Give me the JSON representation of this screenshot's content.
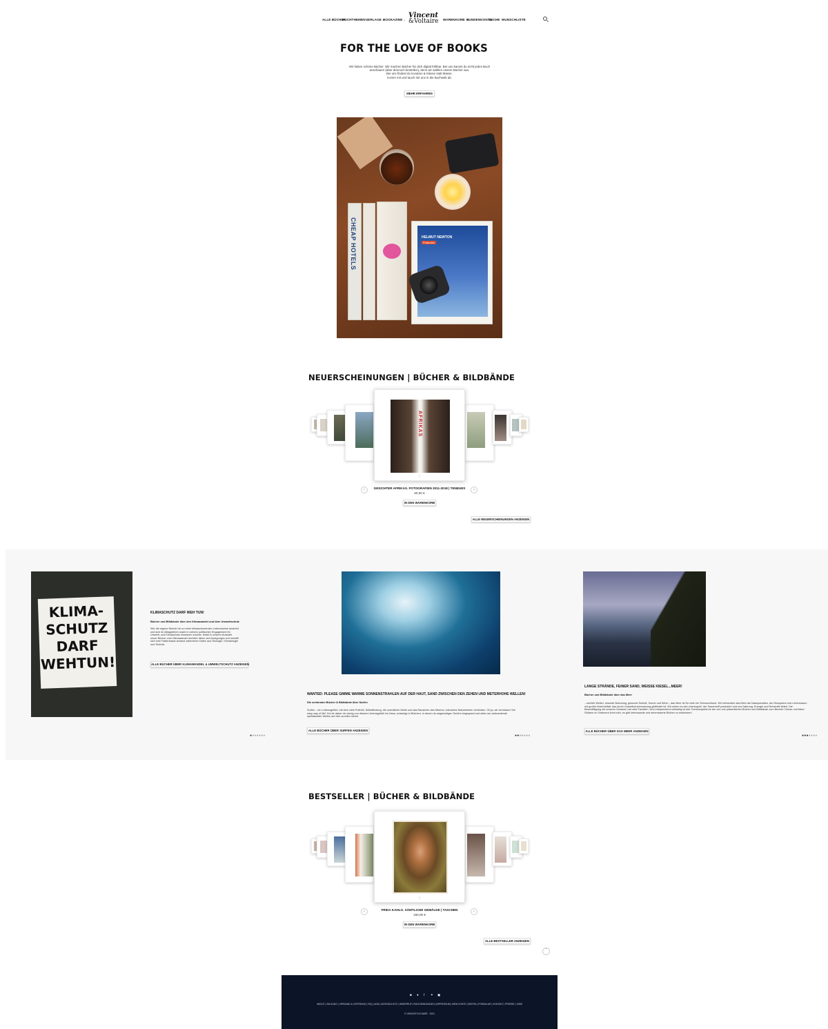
{
  "nav": {
    "left": [
      "ALLE BÜCHER",
      "BUCHTHEMEN",
      "VERLAGE",
      "BOOKAZINE"
    ],
    "right": [
      "WARENKORB",
      "KUNDENKONTO",
      "SUCHE",
      "WUNSCHLISTE"
    ],
    "cart_count": "0",
    "logo_line1": "Vincent",
    "logo_line2": "&Voltaire"
  },
  "hero": {
    "title": "FOR THE LOVE OF BOOKS",
    "lines": [
      "Wir lieben schöne Bücher. Wir machen Bücher für dich digital fühlbar. Bei uns kannst du nicht jedes Buch",
      "anschauen (aber dennoch bestellen), denn wir wählen unsere Bücher aus.",
      "Bei uns findest du Kuration & Klasse statt Masse.",
      "Komm mit und tauch mit uns in die Buchwelt ab."
    ],
    "cta": "MEHR ERFAHREN",
    "photo": {
      "book1": "CHEAP HOTELS",
      "newton_title": "HELMUT NEWTON",
      "newton_sub": "Polaroids"
    }
  },
  "new_releases": {
    "title": "NEUERSCHEINUNGEN | BÜCHER & BILDBÄNDE",
    "product_name": "GESICHTER AFRIKAS. FOTOGRAFIEN 2011-2018 | TENEUES",
    "price": "60,00 €",
    "cart_btn": "IN DEN WARENKORB",
    "all_btn": "ALLE NEUERSCHEINUNGEN ANZEIGEN",
    "cover_text": "AFRIKAS"
  },
  "slides": [
    {
      "sign": "KLIMA-SCHUTZ DARF WEHTUN!",
      "title": "KLIMASCHUTZ DARF WEH TUN!",
      "sub": "Bücher und Bildbände über den Klimawandel und über Umweltschutz",
      "text": "Wer die eigene Wende hin zu einer klimaschonenden Lebensweise anstrebt und sich im Alltagsleben sowie in seinem politischen Engagement für Umwelt- und Klimaschutz einsetzen möchte, findet in unserer Auswahl neuer Bücher zum Klimawandel reichlich Ideen und Anregungen und schafft sich eine Faktenbasis anhand zahlreicher Daten aus Ökologie, Klimatologie und Technik.",
      "btn": "ALLE BÜCHER ÜBER KLIMAWANDEL & UMWELTSCHUTZ ANZEIGEN"
    },
    {
      "title": "WANTED: PLEASE GIMME WARME SONNENSTRAHLEN AUF DER HAUT, SAND ZWISCHEN DEN ZEHEN UND METERHOHE WELLEN!",
      "sub": "Die schönsten Bücher & Bildbände über Surfen",
      "text": "Surfen – ein Lebensgefühl, mit dem viele Freiheit, Selbstfindung, die unendliche Weite und das Rauschen des Meeres, intensives Naturerleben verbinden. Oh ja, wir vermissen 'the easy way of life!' Hol dir daher ein wenig von diesem Lebensgefühl ins Haus; schwelge in Büchern, in denen du wagemutigen Surfern begegnest und stets neu anbrandende spektakuläre Wellen auf dich zurollen siehst.",
      "btn": "ALLE BÜCHER ÜBER SURFEN ANZEIGEN"
    },
    {
      "title": "LANGE STRÄNDE, FEINER SAND, WEISSE KIESEL...MEER!",
      "sub": "Bücher und Bildbände über das Meer",
      "text": "...seichte Wellen, tosende Brandung, gesunde Seeluft, Sonne und Wind – das Meer ist für viele ein Sehnsuchtsort. Wir betrachten das Meer als Naturparadies, als Ökosystem und Lebensraum mit großer Artenvielfalt, das durch Umweltverschmutzung gefährdet ist. Wir sehen es als Lebensquell, der Sauerstoff produziert und uns Nahrung, Energie und Rohstoffe liefert. Die Beschäftigung mit unseren Ozeanen hat viele Facetten. Und entsprechend vielseitig ist das Themenspektrum der von uns präsentierten Bücher und Bildbände zum Bereich 'Ozean und Meer'. Stöbern im Sortiment lohnt sich, es gibt interessante und sehenswerte Bücher zu entdecken!",
      "btn": "ALLE BÜCHER ÜBER DAS MEER ANZEIGEN"
    }
  ],
  "bestseller": {
    "title": "BESTSELLER | BÜCHER & BILDBÄNDE",
    "product_name": "FRIDA KAHLO. SÄMTLICHE GEMÄLDE | TASCHEN",
    "price": "150,00 €",
    "cart_btn": "IN DEN WARENKORB",
    "all_btn": "ALLE BESTSELLER ANZEIGEN"
  },
  "footer": {
    "links": "ABOUT  |  ZAHLUNG  |  VERSAND & LIEFERUNG  |  FAQ  |  AGB  |  DATENSCHUTZ  |  WIDERRUF  |  RÜCKSENDUNGEN  |  IMPRESSUM  |  MEIN KONTO  |  BESTELLFORMULAR  |  KONTAKT  |  PRESSE  |  JOBS",
    "copyright": "© VINCENTVOLTAIRE · 2021",
    "social": [
      "instagram-icon",
      "pinterest-icon",
      "facebook-icon",
      "twitter-icon",
      "linkedin-icon"
    ]
  },
  "colors": {
    "footer_bg": "#0c1428",
    "band_bg": "#f7f7f7"
  }
}
